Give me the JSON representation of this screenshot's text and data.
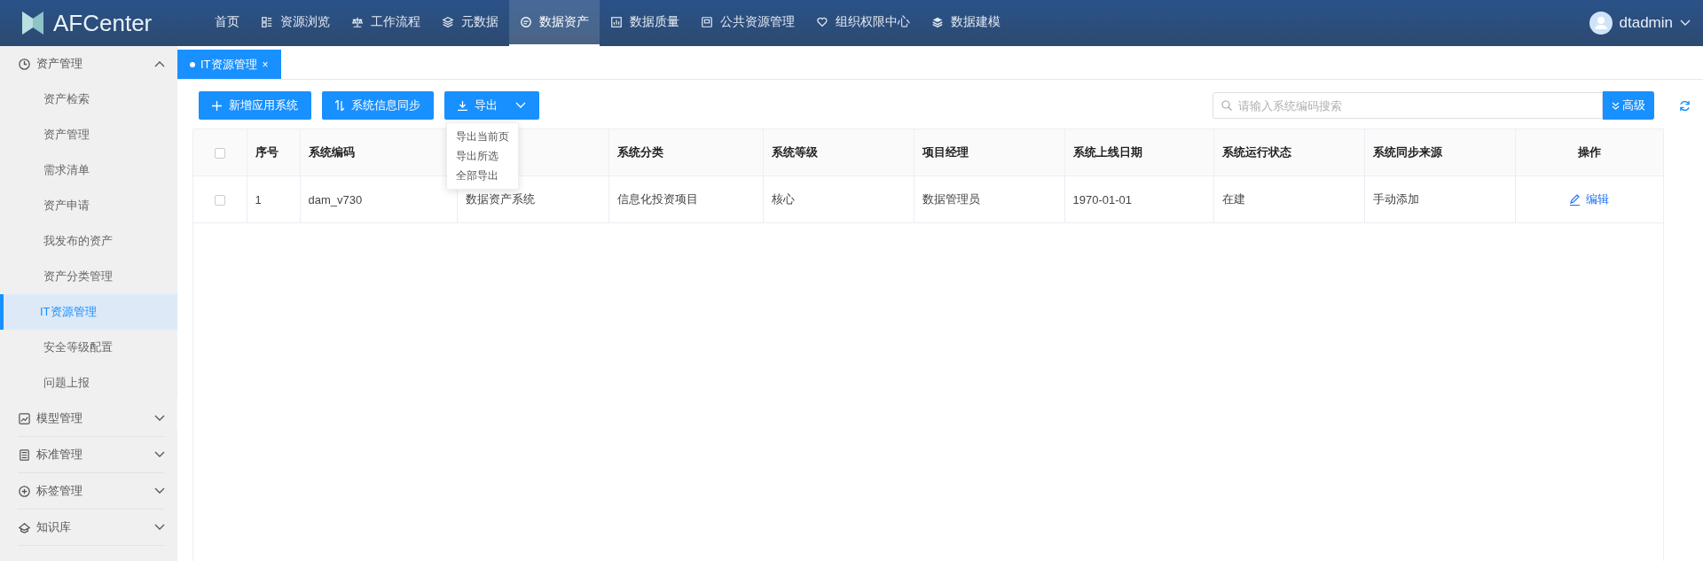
{
  "header": {
    "logo": "AFCenter",
    "nav": [
      {
        "label": "首页",
        "selected": false
      },
      {
        "label": "资源浏览",
        "selected": false
      },
      {
        "label": "工作流程",
        "selected": false
      },
      {
        "label": "元数据",
        "selected": false
      },
      {
        "label": "数据资产",
        "selected": true
      },
      {
        "label": "数据质量",
        "selected": false
      },
      {
        "label": "公共资源管理",
        "selected": false
      },
      {
        "label": "组织权限中心",
        "selected": false
      },
      {
        "label": "数据建模",
        "selected": false
      }
    ],
    "user": "dtadmin"
  },
  "sidebar": {
    "groups": [
      {
        "label": "资产管理",
        "expanded": true,
        "children": [
          {
            "label": "资产检索",
            "selected": false
          },
          {
            "label": "资产管理",
            "selected": false
          },
          {
            "label": "需求清单",
            "selected": false
          },
          {
            "label": "资产申请",
            "selected": false
          },
          {
            "label": "我发布的资产",
            "selected": false
          },
          {
            "label": "资产分类管理",
            "selected": false
          },
          {
            "label": "IT资源管理",
            "selected": true
          },
          {
            "label": "安全等级配置",
            "selected": false
          },
          {
            "label": "问题上报",
            "selected": false
          }
        ]
      },
      {
        "label": "模型管理",
        "expanded": false
      },
      {
        "label": "标准管理",
        "expanded": false
      },
      {
        "label": "标签管理",
        "expanded": false
      },
      {
        "label": "知识库",
        "expanded": false
      }
    ]
  },
  "tabs": [
    {
      "label": "IT资源管理",
      "selected": true,
      "close": "×"
    }
  ],
  "toolbar": {
    "buttons": [
      "新增应用系统",
      "系统信息同步",
      "导出"
    ],
    "export_menu": [
      "导出当前页",
      "导出所选",
      "全部导出"
    ],
    "search": {
      "placeholder": "请输入系统编码搜索"
    },
    "advanced": "高级"
  },
  "table": {
    "header_checked": false,
    "columns": [
      "序号",
      "系统编码",
      null,
      "系统分类",
      "系统等级",
      "项目经理",
      "系统上线日期",
      "系统运行状态",
      "系统同步来源",
      "操作"
    ],
    "rows": [
      {
        "checked": false,
        "cells": [
          "1",
          "dam_v730",
          "数据资产系统",
          "信息化投资项目",
          "核心",
          "数据管理员",
          "1970-01-01",
          "在建",
          "手动添加"
        ],
        "action": "编辑"
      }
    ]
  }
}
